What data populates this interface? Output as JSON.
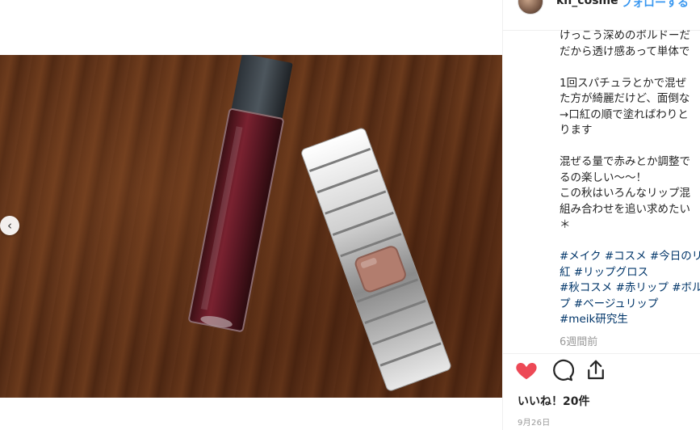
{
  "post": {
    "username": "kn_cosme",
    "separator": "•",
    "follow_label": "フォローする"
  },
  "caption": {
    "lines": [
      "けっこう深めのボルドーだ",
      "だから透け感あって単体で",
      "",
      "1回スパチュラとかで混ぜ",
      "た方が綺麗だけど、面倒な",
      "→口紅の順で塗ればわりと",
      "ります",
      "",
      "混ぜる量で赤みとか調整で",
      "るの楽しい〜〜！",
      "この秋はいろんなリップ混",
      "組み合わせを追い求めたい",
      "＊",
      "",
      "#メイク #コスメ #今日のリ",
      "紅 #リップグロス",
      "#秋コスメ #赤リップ #ボル",
      "プ #ベージュリップ",
      "#meik研究生"
    ],
    "time_ago": "6週間前"
  },
  "actions": {
    "like_icon": "heart-icon",
    "comment_icon": "comment-icon",
    "share_icon": "share-icon",
    "like_color": "#ed4956"
  },
  "likes_text": "いいね！20件",
  "date_text": "9月26日",
  "carousel": {
    "prev_glyph": "‹"
  }
}
